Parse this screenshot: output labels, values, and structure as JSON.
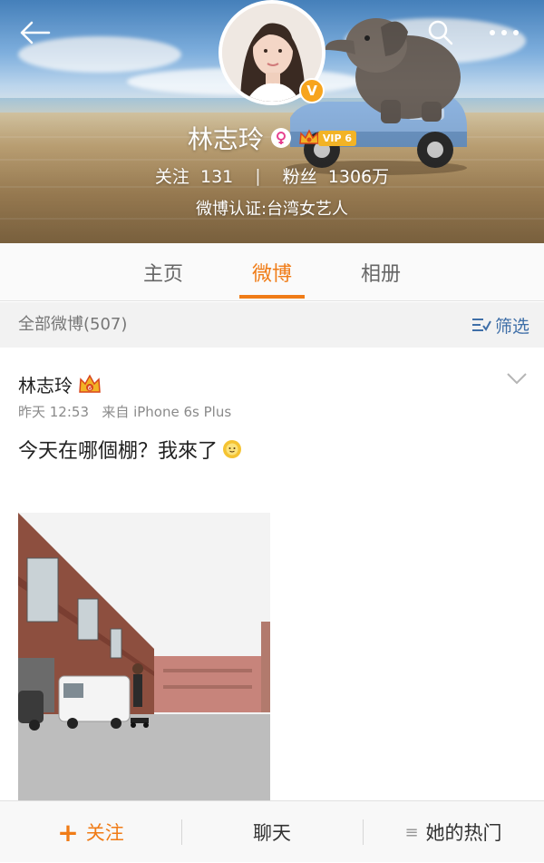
{
  "header": {
    "name": "林志玲",
    "vip_label": "VIP 6",
    "verified_badge": "V",
    "following_label": "关注",
    "following_count": "131",
    "divider": "|",
    "followers_label": "粉丝",
    "followers_count": "1306万",
    "certification": "微博认证:台湾女艺人",
    "icons": [
      "back-arrow-icon",
      "search-icon",
      "more-icon",
      "female-gender-icon",
      "vip-crown-icon"
    ]
  },
  "tabs": [
    {
      "label": "主页",
      "active": false
    },
    {
      "label": "微博",
      "active": true
    },
    {
      "label": "相册",
      "active": false
    }
  ],
  "filter": {
    "count_text": "全部微博(507)",
    "filter_label": "筛选"
  },
  "post": {
    "author": "林志玲",
    "time": "昨天 12:53",
    "source": "来自 iPhone 6s Plus",
    "text": "今天在哪個棚？我來了"
  },
  "bottom_bar": {
    "follow_icon": "+",
    "follow_label": "关注",
    "chat_label": "聊天",
    "hot_icon": "≡",
    "hot_label": "她的热门"
  },
  "colors": {
    "accent": "#f07c17",
    "link_blue": "#3f6fa8",
    "vip_gold": "#f2b326"
  }
}
